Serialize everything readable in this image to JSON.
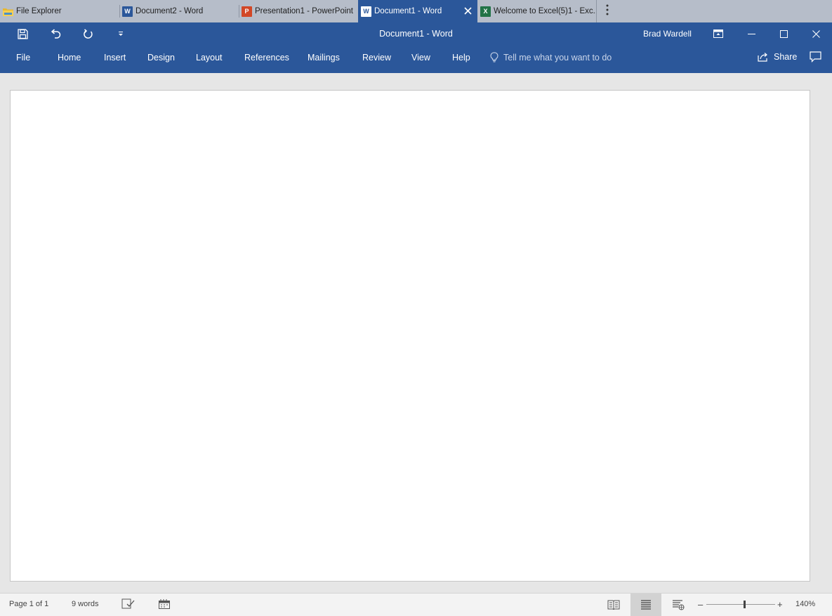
{
  "tabs": [
    {
      "label": "File Explorer",
      "icon": "folder-icon",
      "active": false
    },
    {
      "label": "Document2 - Word",
      "icon": "word-icon",
      "active": false
    },
    {
      "label": "Presentation1 - PowerPoint",
      "icon": "powerpoint-icon",
      "active": false
    },
    {
      "label": "Document1 - Word",
      "icon": "word-icon",
      "active": true
    },
    {
      "label": "Welcome to Excel(5)1 - Exc...",
      "icon": "excel-icon",
      "active": false
    }
  ],
  "titlebar": {
    "title": "Document1  -  Word",
    "user": "Brad Wardell"
  },
  "ribbon": {
    "tabs": [
      "File",
      "Home",
      "Insert",
      "Design",
      "Layout",
      "References",
      "Mailings",
      "Review",
      "View",
      "Help"
    ],
    "tell_me": "Tell me what you want to do",
    "share": "Share"
  },
  "status": {
    "page": "Page 1 of 1",
    "words": "9 words",
    "zoom": "140%"
  },
  "colors": {
    "word_blue": "#2b579a",
    "tabstrip": "#b6bdc9",
    "excel_green": "#217346",
    "powerpoint_red": "#d24726"
  }
}
